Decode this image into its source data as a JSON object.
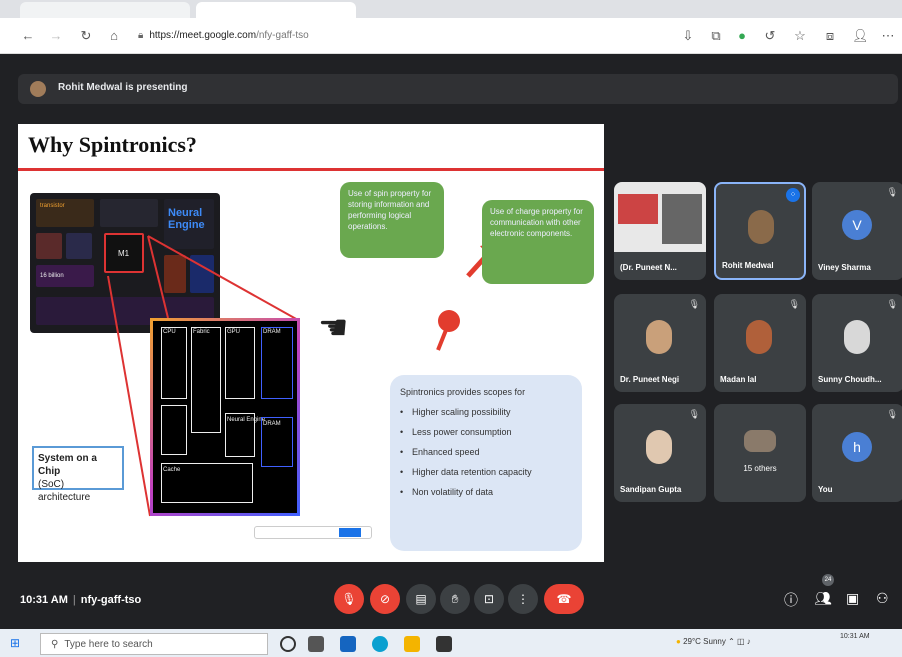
{
  "browser": {
    "url_host": "https://meet.google.com",
    "url_path": "/nfy-gaff-tso"
  },
  "presenting": {
    "text": "Rohit Medwal is presenting"
  },
  "slide": {
    "title": "Why Spintronics?",
    "chip_labels": {
      "transistors": "transistor",
      "neural": "Neural Engine",
      "chip_name": "M1",
      "billion": "16 billion"
    },
    "zoom_labels": [
      "CPU",
      "Fabric",
      "GPU",
      "DRAM",
      "DRAM",
      "Neural Engine",
      "Cache"
    ],
    "soc_label_line1": "System on a Chip",
    "soc_label_line2": "(SoC) architecture",
    "bubble_spin": "Use of spin property for storing information and performing logical operations.",
    "bubble_charge": "Use of charge property for communication with other electronic components.",
    "spin_box_title": "Spintronics provides scopes for",
    "spin_points": [
      "Higher scaling possibility",
      "Less power consumption",
      "Enhanced speed",
      "Higher data retention capacity",
      "Non volatility of data"
    ]
  },
  "participants": [
    {
      "name": "(Dr. Puneet N...",
      "type": "screen"
    },
    {
      "name": "Rohit Medwal",
      "type": "photo",
      "active": true
    },
    {
      "name": "Viney Sharma",
      "type": "letter",
      "letter": "V",
      "color": "#1a73e8"
    },
    {
      "name": "Dr. Puneet Negi",
      "type": "photo"
    },
    {
      "name": "Madan lal",
      "type": "photo"
    },
    {
      "name": "Sunny Choudh...",
      "type": "photo"
    },
    {
      "name": "Sandipan Gupta",
      "type": "photo"
    },
    {
      "name": "15 others",
      "type": "group"
    },
    {
      "name": "You",
      "type": "letter",
      "letter": "h",
      "color": "#4285f4"
    }
  ],
  "controls": {
    "time": "10:31 AM",
    "meeting_code": "nfy-gaff-tso",
    "people_count": "24"
  },
  "taskbar": {
    "search_placeholder": "Type here to search",
    "weather": "29°C Sunny",
    "clock": "10:31 AM"
  }
}
